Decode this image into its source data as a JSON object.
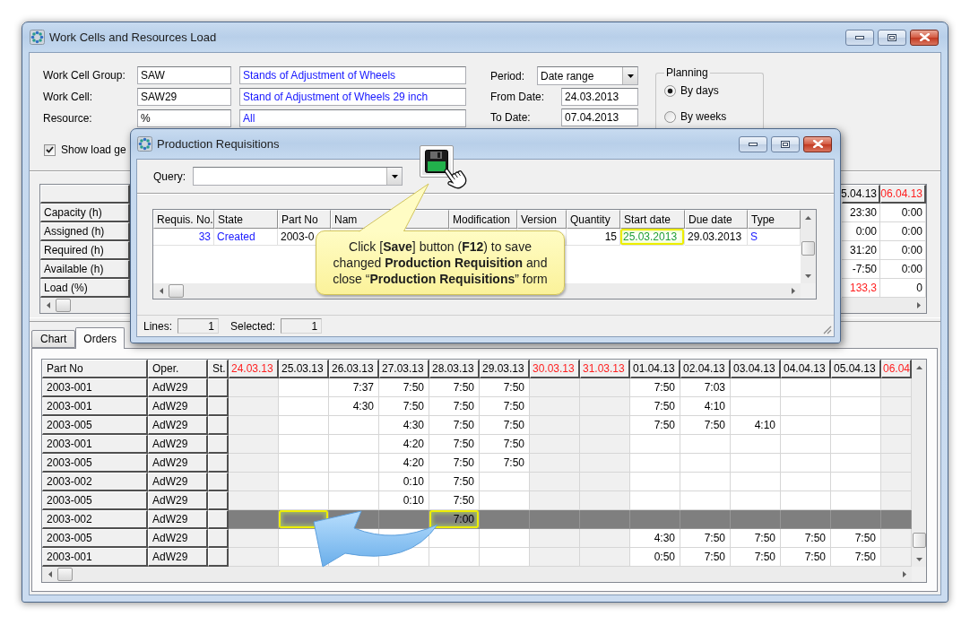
{
  "main_window": {
    "title": "Work Cells and Resources Load"
  },
  "filters": [
    {
      "label": "Work Cell Group:",
      "code": "SAW",
      "description": "Stands of Adjustment of Wheels"
    },
    {
      "label": "Work Cell:",
      "code": "SAW29",
      "description": "Stand of Adjustment of Wheels 29 inch"
    },
    {
      "label": "Resource:",
      "code": "%",
      "description": "All"
    }
  ],
  "show_load": {
    "label": "Show load ge",
    "checked": true
  },
  "period": {
    "label": "Period:",
    "value": "Date range"
  },
  "dates": [
    {
      "label": "From Date:",
      "value": "24.03.2013"
    },
    {
      "label": "To Date:",
      "value": "07.04.2013"
    }
  ],
  "planning": {
    "title": "Planning",
    "options": [
      {
        "label": "By days",
        "selected": true
      },
      {
        "label": "By weeks",
        "selected": false
      }
    ]
  },
  "load_grid": {
    "row_labels": [
      "Capacity (h)",
      "Assigned (h)",
      "Required (h)",
      "Available (h)",
      "Load (%)"
    ],
    "columns": [
      {
        "label": "5.04.13",
        "weekend": false,
        "values": [
          "23:30",
          "0:00",
          "31:20",
          "-7:50",
          "133,3"
        ],
        "alerts": [
          false,
          false,
          false,
          false,
          true
        ]
      },
      {
        "label": "06.04.13",
        "weekend": true,
        "values": [
          "0:00",
          "0:00",
          "0:00",
          "0:00",
          "0"
        ],
        "alerts": [
          false,
          false,
          false,
          false,
          false
        ]
      }
    ]
  },
  "tabs": [
    {
      "label": "Chart",
      "selected": false
    },
    {
      "label": "Orders",
      "selected": true
    }
  ],
  "orders": {
    "fixed_columns": [
      "Part No",
      "Oper.",
      "St."
    ],
    "date_columns": [
      {
        "label": "24.03.13",
        "weekend": true
      },
      {
        "label": "25.03.13",
        "weekend": false
      },
      {
        "label": "26.03.13",
        "weekend": false
      },
      {
        "label": "27.03.13",
        "weekend": false
      },
      {
        "label": "28.03.13",
        "weekend": false
      },
      {
        "label": "29.03.13",
        "weekend": false
      },
      {
        "label": "30.03.13",
        "weekend": true
      },
      {
        "label": "31.03.13",
        "weekend": true
      },
      {
        "label": "01.04.13",
        "weekend": false
      },
      {
        "label": "02.04.13",
        "weekend": false
      },
      {
        "label": "03.04.13",
        "weekend": false
      },
      {
        "label": "04.04.13",
        "weekend": false
      },
      {
        "label": "05.04.13",
        "weekend": false
      },
      {
        "label": "06.04",
        "weekend": true
      }
    ],
    "rows": [
      {
        "part_no": "2003-001",
        "oper": "AdW29",
        "selected": false,
        "cells": [
          null,
          null,
          "7:37",
          "7:50",
          "7:50",
          "7:50",
          null,
          null,
          "7:50",
          "7:03",
          null,
          null,
          null,
          null
        ],
        "highlighted": [
          false,
          false,
          false,
          false,
          false,
          false,
          false,
          false,
          false,
          false,
          false,
          false,
          false,
          false
        ]
      },
      {
        "part_no": "2003-001",
        "oper": "AdW29",
        "selected": false,
        "cells": [
          null,
          null,
          "4:30",
          "7:50",
          "7:50",
          "7:50",
          null,
          null,
          "7:50",
          "4:10",
          null,
          null,
          null,
          null
        ],
        "highlighted": [
          false,
          false,
          false,
          false,
          false,
          false,
          false,
          false,
          false,
          false,
          false,
          false,
          false,
          false
        ]
      },
      {
        "part_no": "2003-005",
        "oper": "AdW29",
        "selected": false,
        "cells": [
          null,
          null,
          null,
          "4:30",
          "7:50",
          "7:50",
          null,
          null,
          "7:50",
          "7:50",
          "4:10",
          null,
          null,
          null
        ],
        "highlighted": [
          false,
          false,
          false,
          false,
          false,
          false,
          false,
          false,
          false,
          false,
          false,
          false,
          false,
          false
        ]
      },
      {
        "part_no": "2003-001",
        "oper": "AdW29",
        "selected": false,
        "cells": [
          null,
          null,
          null,
          "4:20",
          "7:50",
          "7:50",
          null,
          null,
          null,
          null,
          null,
          null,
          null,
          null
        ],
        "highlighted": [
          false,
          false,
          false,
          false,
          false,
          false,
          false,
          false,
          false,
          false,
          false,
          false,
          false,
          false
        ]
      },
      {
        "part_no": "2003-005",
        "oper": "AdW29",
        "selected": false,
        "cells": [
          null,
          null,
          null,
          "4:20",
          "7:50",
          "7:50",
          null,
          null,
          null,
          null,
          null,
          null,
          null,
          null
        ],
        "highlighted": [
          false,
          false,
          false,
          false,
          false,
          false,
          false,
          false,
          false,
          false,
          false,
          false,
          false,
          false
        ]
      },
      {
        "part_no": "2003-002",
        "oper": "AdW29",
        "selected": false,
        "cells": [
          null,
          null,
          null,
          "0:10",
          "7:50",
          null,
          null,
          null,
          null,
          null,
          null,
          null,
          null,
          null
        ],
        "highlighted": [
          false,
          false,
          false,
          false,
          false,
          false,
          false,
          false,
          false,
          false,
          false,
          false,
          false,
          false
        ]
      },
      {
        "part_no": "2003-005",
        "oper": "AdW29",
        "selected": false,
        "cells": [
          null,
          null,
          null,
          "0:10",
          "7:50",
          null,
          null,
          null,
          null,
          null,
          null,
          null,
          null,
          null
        ],
        "highlighted": [
          false,
          false,
          false,
          false,
          false,
          false,
          false,
          false,
          false,
          false,
          false,
          false,
          false,
          false
        ]
      },
      {
        "part_no": "2003-002",
        "oper": "AdW29",
        "selected": true,
        "cells": [
          null,
          null,
          null,
          null,
          "7:00",
          null,
          null,
          null,
          null,
          null,
          null,
          null,
          null,
          null
        ],
        "highlighted": [
          false,
          true,
          false,
          false,
          true,
          false,
          false,
          false,
          false,
          false,
          false,
          false,
          false,
          false
        ]
      },
      {
        "part_no": "2003-005",
        "oper": "AdW29",
        "selected": false,
        "cells": [
          null,
          null,
          null,
          null,
          null,
          null,
          null,
          null,
          "4:30",
          "7:50",
          "7:50",
          "7:50",
          "7:50",
          null
        ],
        "highlighted": [
          false,
          false,
          false,
          false,
          false,
          false,
          false,
          false,
          false,
          false,
          false,
          false,
          false,
          false
        ]
      },
      {
        "part_no": "2003-001",
        "oper": "AdW29",
        "selected": false,
        "cells": [
          null,
          null,
          null,
          null,
          null,
          null,
          null,
          null,
          "0:50",
          "7:50",
          "7:50",
          "7:50",
          "7:50",
          null
        ],
        "highlighted": [
          false,
          false,
          false,
          false,
          false,
          false,
          false,
          false,
          false,
          false,
          false,
          false,
          false,
          false
        ]
      }
    ]
  },
  "dialog": {
    "title": "Production Requisitions",
    "query": {
      "label": "Query:"
    },
    "columns": [
      {
        "label": "Requis. No.",
        "kind": "key"
      },
      {
        "label": "State",
        "kind": "status"
      },
      {
        "label": "Part No",
        "kind": "text"
      },
      {
        "label": "Nam",
        "kind": "text"
      },
      {
        "label": "Modification",
        "kind": "text"
      },
      {
        "label": "Version",
        "kind": "text"
      },
      {
        "label": "Quantity",
        "kind": "number"
      },
      {
        "label": "Start date",
        "kind": "date"
      },
      {
        "label": "Due date",
        "kind": "date"
      },
      {
        "label": "Type",
        "kind": "code"
      }
    ],
    "rows": [
      {
        "requis_no": "33",
        "state": "Created",
        "part_no": "2003-0",
        "quantity": "15",
        "start_date": "25.03.2013",
        "start_date_edited": true,
        "due_date": "29.03.2013",
        "type": "S"
      }
    ],
    "status_bar": {
      "lines_label": "Lines:",
      "lines_value": "1",
      "selected_label": "Selected:",
      "selected_value": "1"
    }
  },
  "callout": {
    "text": "Click [**Save**] button (**F12**) to save changed **Production Requisition** and close “**Production Requisitions**” form"
  }
}
